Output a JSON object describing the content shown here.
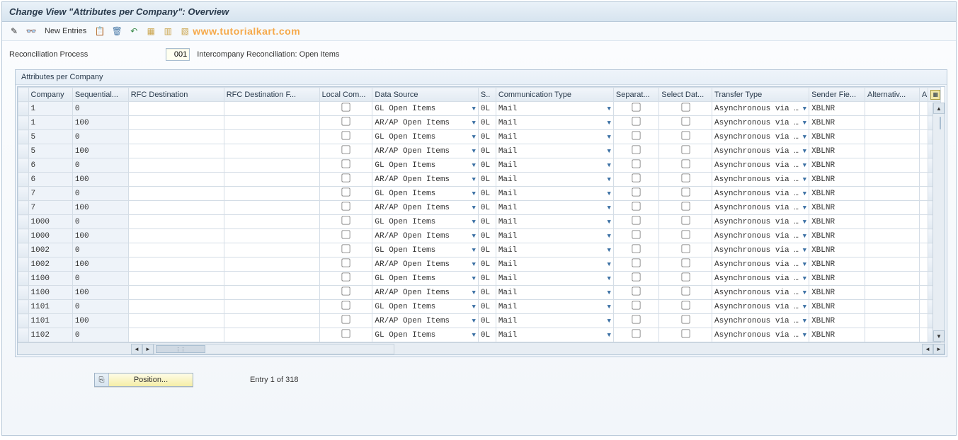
{
  "title": "Change View \"Attributes per Company\": Overview",
  "toolbar": {
    "new_entries_label": "New Entries",
    "icons": [
      "pencil-check-icon",
      "glasses-icon",
      "copy-icon",
      "page-icon",
      "undo-icon",
      "save-icon",
      "table-icon",
      "variant-icon"
    ]
  },
  "watermark": "www.tutorialkart.com",
  "context": {
    "label": "Reconciliation Process",
    "value": "001",
    "description": "Intercompany Reconciliation: Open Items"
  },
  "panel_title": "Attributes per Company",
  "columns": {
    "company": "Company",
    "sequential": "Sequential...",
    "rfc_dest": "RFC Destination",
    "rfc_dest_f": "RFC Destination F...",
    "local_com": "Local Com...",
    "data_source": "Data Source",
    "s": "S..",
    "comm_type": "Communication Type",
    "separat": "Separat...",
    "select_dat": "Select Dat...",
    "transfer_type": "Transfer Type",
    "sender_fie": "Sender Fie...",
    "alternativ": "Alternativ...",
    "a": "A"
  },
  "rows": [
    {
      "company": "1",
      "seq": "0",
      "ds": "GL Open Items",
      "s": "0L",
      "ct": "Mail",
      "tt": "Asynchronous via …",
      "sf": "XBLNR"
    },
    {
      "company": "1",
      "seq": "100",
      "ds": "AR/AP Open Items",
      "s": "0L",
      "ct": "Mail",
      "tt": "Asynchronous via …",
      "sf": "XBLNR"
    },
    {
      "company": "5",
      "seq": "0",
      "ds": "GL Open Items",
      "s": "0L",
      "ct": "Mail",
      "tt": "Asynchronous via …",
      "sf": "XBLNR"
    },
    {
      "company": "5",
      "seq": "100",
      "ds": "AR/AP Open Items",
      "s": "0L",
      "ct": "Mail",
      "tt": "Asynchronous via …",
      "sf": "XBLNR"
    },
    {
      "company": "6",
      "seq": "0",
      "ds": "GL Open Items",
      "s": "0L",
      "ct": "Mail",
      "tt": "Asynchronous via …",
      "sf": "XBLNR"
    },
    {
      "company": "6",
      "seq": "100",
      "ds": "AR/AP Open Items",
      "s": "0L",
      "ct": "Mail",
      "tt": "Asynchronous via …",
      "sf": "XBLNR"
    },
    {
      "company": "7",
      "seq": "0",
      "ds": "GL Open Items",
      "s": "0L",
      "ct": "Mail",
      "tt": "Asynchronous via …",
      "sf": "XBLNR"
    },
    {
      "company": "7",
      "seq": "100",
      "ds": "AR/AP Open Items",
      "s": "0L",
      "ct": "Mail",
      "tt": "Asynchronous via …",
      "sf": "XBLNR"
    },
    {
      "company": "1000",
      "seq": "0",
      "ds": "GL Open Items",
      "s": "0L",
      "ct": "Mail",
      "tt": "Asynchronous via …",
      "sf": "XBLNR"
    },
    {
      "company": "1000",
      "seq": "100",
      "ds": "AR/AP Open Items",
      "s": "0L",
      "ct": "Mail",
      "tt": "Asynchronous via …",
      "sf": "XBLNR"
    },
    {
      "company": "1002",
      "seq": "0",
      "ds": "GL Open Items",
      "s": "0L",
      "ct": "Mail",
      "tt": "Asynchronous via …",
      "sf": "XBLNR"
    },
    {
      "company": "1002",
      "seq": "100",
      "ds": "AR/AP Open Items",
      "s": "0L",
      "ct": "Mail",
      "tt": "Asynchronous via …",
      "sf": "XBLNR"
    },
    {
      "company": "1100",
      "seq": "0",
      "ds": "GL Open Items",
      "s": "0L",
      "ct": "Mail",
      "tt": "Asynchronous via …",
      "sf": "XBLNR"
    },
    {
      "company": "1100",
      "seq": "100",
      "ds": "AR/AP Open Items",
      "s": "0L",
      "ct": "Mail",
      "tt": "Asynchronous via …",
      "sf": "XBLNR"
    },
    {
      "company": "1101",
      "seq": "0",
      "ds": "GL Open Items",
      "s": "0L",
      "ct": "Mail",
      "tt": "Asynchronous via …",
      "sf": "XBLNR"
    },
    {
      "company": "1101",
      "seq": "100",
      "ds": "AR/AP Open Items",
      "s": "0L",
      "ct": "Mail",
      "tt": "Asynchronous via …",
      "sf": "XBLNR"
    },
    {
      "company": "1102",
      "seq": "0",
      "ds": "GL Open Items",
      "s": "0L",
      "ct": "Mail",
      "tt": "Asynchronous via …",
      "sf": "XBLNR"
    }
  ],
  "footer": {
    "position_label": "Position...",
    "entry_info": "Entry 1 of 318"
  }
}
